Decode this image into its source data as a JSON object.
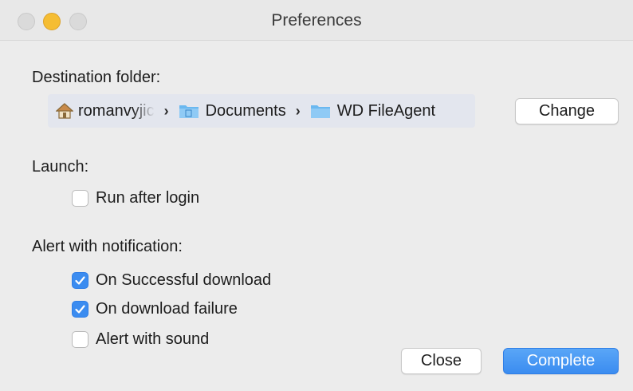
{
  "window": {
    "title": "Preferences"
  },
  "destination": {
    "label": "Destination folder:",
    "path": [
      {
        "name": "romanvyjic",
        "icon": "home-icon"
      },
      {
        "name": "Documents",
        "icon": "folder-icon"
      },
      {
        "name": "WD FileAgent",
        "icon": "folder-icon"
      }
    ],
    "separator": "›",
    "change_label": "Change"
  },
  "launch": {
    "label": "Launch:",
    "run_after_login": {
      "label": "Run after login",
      "checked": false
    }
  },
  "alerts": {
    "label": "Alert with notification:",
    "successful_download": {
      "label": "On Successful download",
      "checked": true
    },
    "download_failure": {
      "label": "On download failure",
      "checked": true
    },
    "alert_sound": {
      "label": "Alert with sound",
      "checked": false
    }
  },
  "footer": {
    "close_label": "Close",
    "complete_label": "Complete"
  },
  "colors": {
    "accent": "#3b8cf0",
    "window_bg": "#ececec",
    "path_bg": "#e3e6ee",
    "folder": "#6ab8f0"
  }
}
